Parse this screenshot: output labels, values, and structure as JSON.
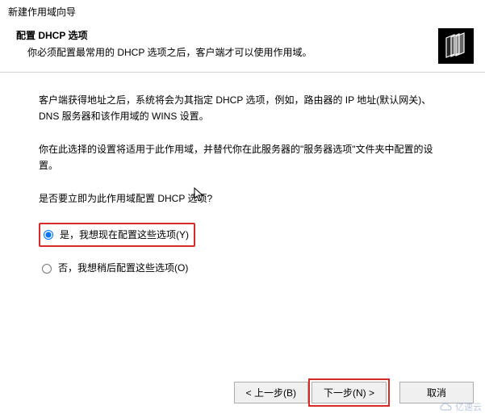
{
  "window": {
    "title": "新建作用域向导"
  },
  "header": {
    "title": "配置 DHCP 选项",
    "subtitle": "你必须配置最常用的 DHCP 选项之后，客户端才可以使用作用域。"
  },
  "body": {
    "para1": "客户端获得地址之后，系统将会为其指定 DHCP 选项，例如，路由器的 IP 地址(默认网关)、DNS 服务器和该作用域的 WINS 设置。",
    "para2": "你在此选择的设置将适用于此作用域，并替代你在此服务器的\"服务器选项\"文件夹中配置的设置。",
    "question": "是否要立即为此作用域配置 DHCP 选项?"
  },
  "options": {
    "yes": "是，我想现在配置这些选项(Y)",
    "no": "否，我想稍后配置这些选项(O)"
  },
  "buttons": {
    "back": "< 上一步(B)",
    "next": "下一步(N) >",
    "cancel": "取消"
  },
  "watermark": "亿速云"
}
